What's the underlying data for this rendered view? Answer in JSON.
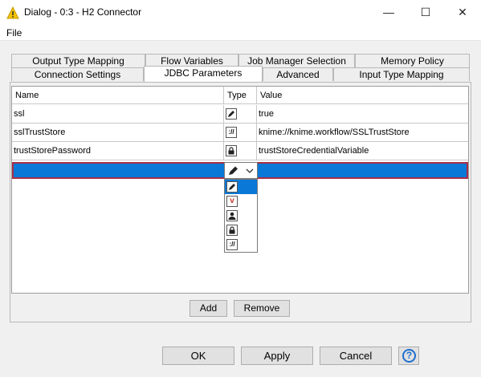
{
  "window": {
    "title": "Dialog - 0:3 - H2 Connector",
    "minimize_glyph": "—",
    "maximize_glyph": "☐",
    "close_glyph": "✕",
    "icon": "knime-warning-triangle-icon"
  },
  "menu": {
    "file_label": "File"
  },
  "tabs": {
    "output_type_mapping": "Output Type Mapping",
    "flow_variables": "Flow Variables",
    "job_manager_selection": "Job Manager Selection",
    "memory_policy": "Memory Policy",
    "connection_settings": "Connection Settings",
    "jdbc_parameters": "JDBC Parameters",
    "advanced": "Advanced",
    "input_type_mapping": "Input Type Mapping",
    "active": "JDBC Parameters"
  },
  "table": {
    "headers": {
      "name": "Name",
      "type": "Type",
      "value": "Value"
    },
    "rows": [
      {
        "name": "ssl",
        "type_icon": "pencil-icon",
        "value": "true"
      },
      {
        "name": "sslTrustStore",
        "type_icon": "url-icon",
        "type_text": "://",
        "value": "knime://knime.workflow/SSLTrustStore"
      },
      {
        "name": "trustStorePassword",
        "type_icon": "lock-icon",
        "value": "trustStoreCredentialVariable"
      },
      {
        "name": "",
        "type_icon": "pencil-icon",
        "value": ""
      }
    ],
    "dropdown_options": [
      {
        "icon": "pencil-icon"
      },
      {
        "icon": "flow-variable-icon",
        "text": "v"
      },
      {
        "icon": "user-icon"
      },
      {
        "icon": "lock-icon"
      },
      {
        "icon": "url-icon",
        "text": "://"
      }
    ],
    "dropdown_selected_index": 0
  },
  "buttons": {
    "add": "Add",
    "remove": "Remove",
    "ok": "OK",
    "apply": "Apply",
    "cancel": "Cancel",
    "help": "?"
  },
  "colors": {
    "selection": "#0a78d7",
    "selection_border": "#a62e45",
    "accent": "#1e6fcf",
    "warning_yellow": "#f5c400"
  }
}
